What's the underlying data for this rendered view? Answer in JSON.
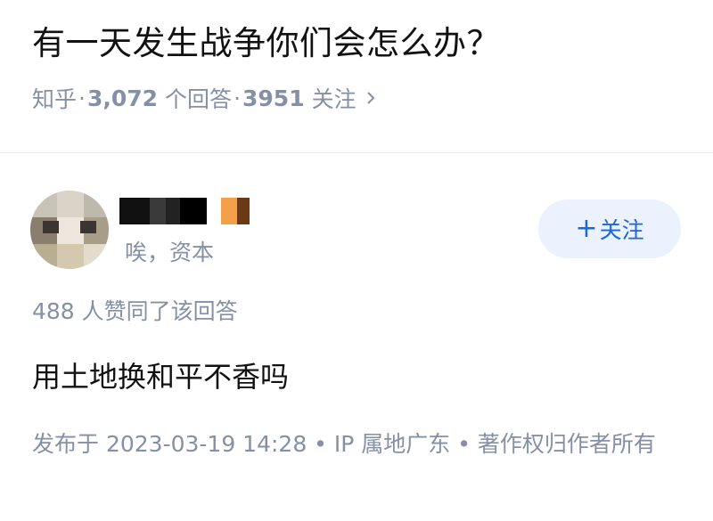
{
  "question": {
    "title": "有一天发生战争你们会怎么办？",
    "source": "知乎",
    "answer_count": "3,072",
    "answer_label": "个回答",
    "follower_count": "3951",
    "follower_label": "关注",
    "separator": "·",
    "chevron": "›"
  },
  "author": {
    "headline": "唉，资本"
  },
  "follow_button": {
    "plus": "+",
    "label": "关注",
    "bg_color": "#ebf2fd",
    "text_color": "#1a66dc"
  },
  "answer": {
    "vote_text": "488 人赞同了该回答",
    "content": "用土地换和平不香吗",
    "footer": "发布于 2023-03-19 14:28 • IP 属地广东 • 著作权归作者所有"
  },
  "colors": {
    "meta_gray": "#8590a6",
    "title_black": "#121212"
  }
}
